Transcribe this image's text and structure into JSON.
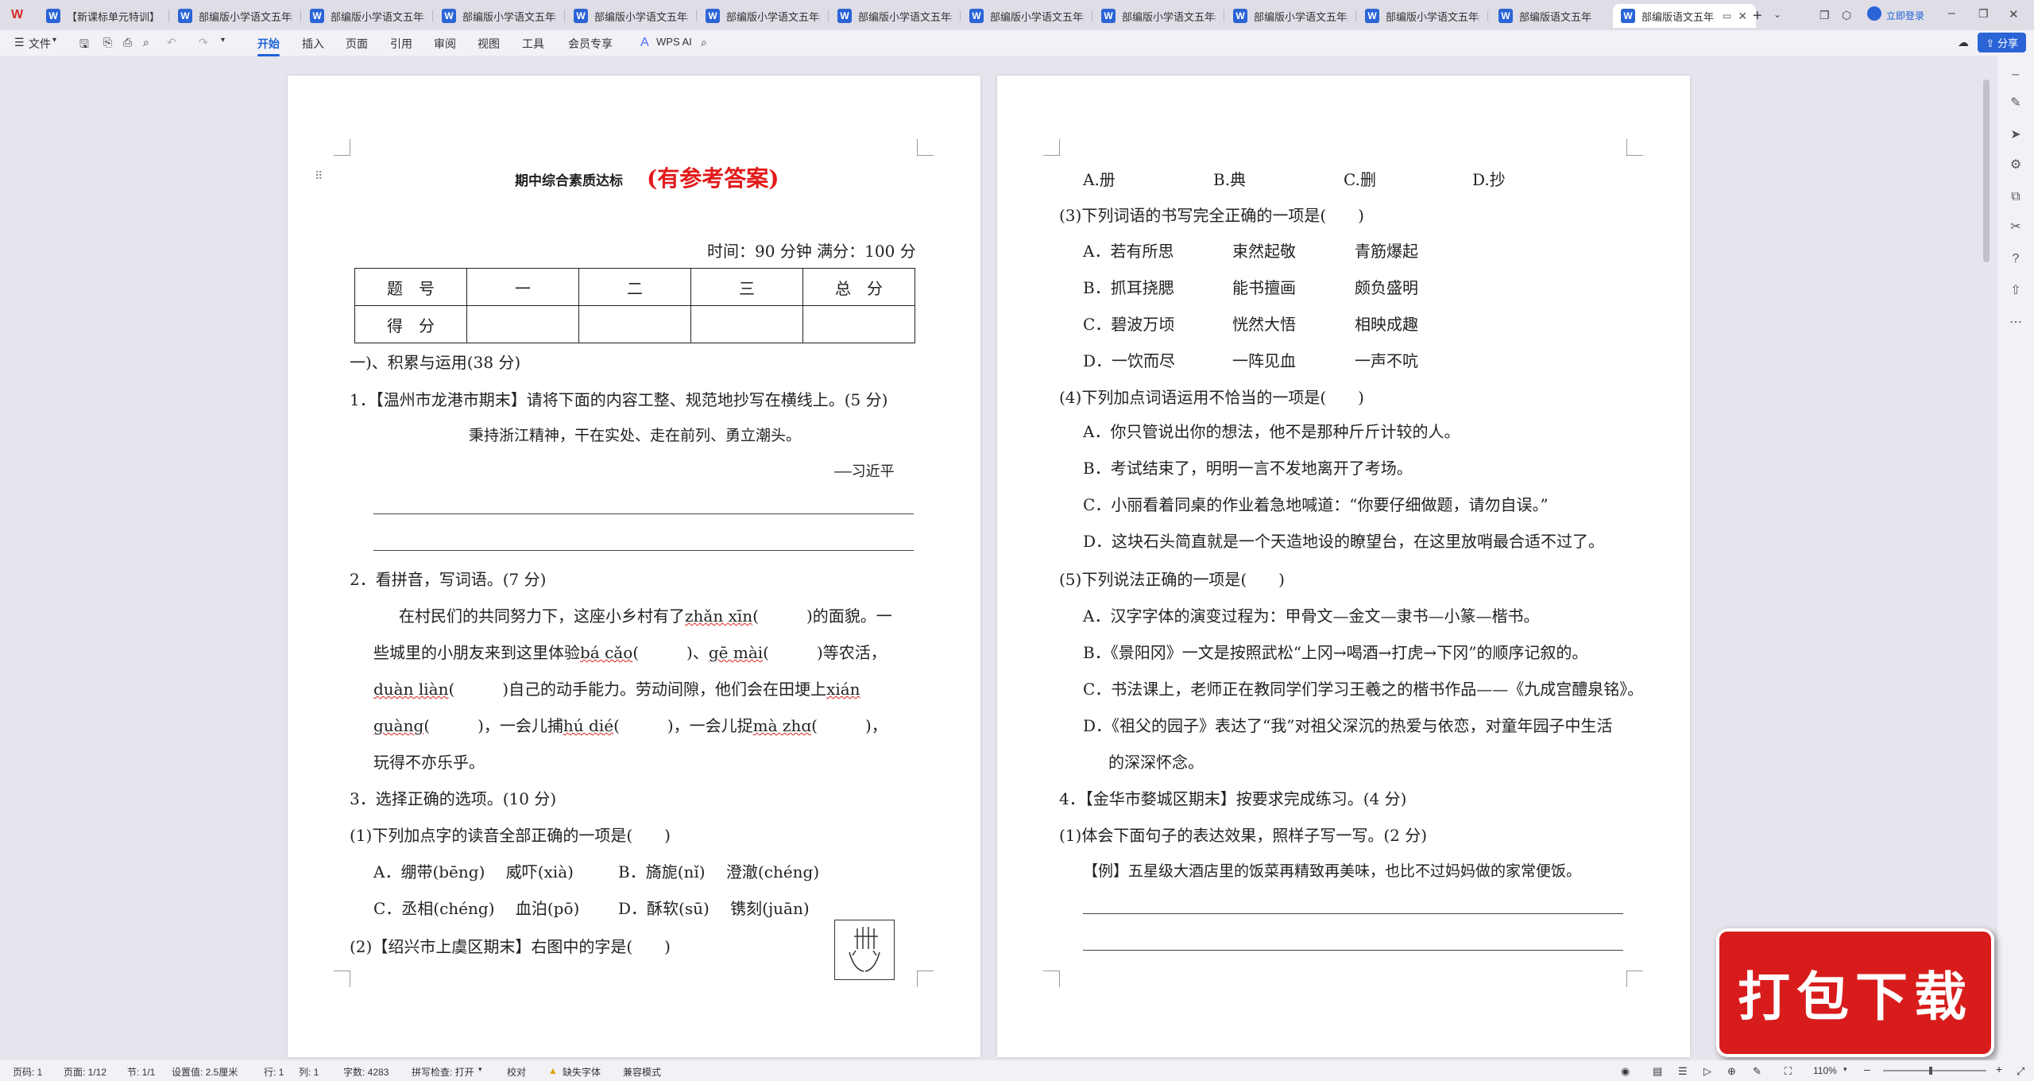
{
  "app": {
    "tabs": [
      "【新课标单元特训】",
      "部编版小学语文五年级",
      "部编版小学语文五年级",
      "部编版小学语文五年级",
      "部编版小学语文五年级",
      "部编版小学语文五年级",
      "部编版小学语文五年级",
      "部编版小学语文五年级",
      "部编版小学语文五年级",
      "部编版小学语文五年级",
      "部编版小学语文五年级",
      "部编版语文五年"
    ],
    "login": "立即登录",
    "share": "分享",
    "file_menu": "文件",
    "menus": [
      "开始",
      "插入",
      "页面",
      "引用",
      "审阅",
      "视图",
      "工具",
      "会员专享"
    ],
    "wps_ai": "WPS AI"
  },
  "status": {
    "page_code": "页码: 1",
    "page": "页面: 1/12",
    "section": "节: 1/1",
    "setting": "设置值: 2.5厘米",
    "row": "行: 1",
    "col": "列: 1",
    "words": "字数: 4283",
    "spell": "拼写检查: 打开",
    "proof": "校对",
    "missing_font": "缺失字体",
    "compat": "兼容模式",
    "zoom": "110%"
  },
  "doc": {
    "title_small": "期中综合素质达标",
    "title_big": "(有参考答案)",
    "time_line": "时间：90 分钟   满分：100 分",
    "table_header": [
      "题　号",
      "一",
      "二",
      "三",
      "总　分"
    ],
    "table_row2": "得　分",
    "sec1": "一)、积累与运用(38 分)",
    "q1": "1．【温州市龙港市期末】请将下面的内容工整、规范地抄写在横线上。(5 分)",
    "q1_quote": "秉持浙江精神，干在实处、走在前列、勇立潮头。",
    "q1_author": "——习近平",
    "q2": "2．看拼音，写词语。(7 分)",
    "q2_l1a": "在村民们的共同努力下，这座小乡村有了",
    "q2_p1": "zhǎn xīn",
    "q2_l1b": "的面貌。一",
    "q2_l2a": "些城里的小朋友来到这里体验",
    "q2_p2": "bá cǎo",
    "q2_p3": "gē mài",
    "q2_l2b": "等农活，",
    "q2_p4": "duàn liàn",
    "q2_l3a": "自己的动手能力。劳动间隙，他们会在田埂上",
    "q2_p5": "xián",
    "q2_p5b": "guàng",
    "q2_l4a": "，一会儿捕",
    "q2_p6": "hú dié",
    "q2_l4b": "，一会儿捉",
    "q2_p7": "mà zhɑ",
    "q2_l5": "玩得不亦乐乎。",
    "q3": "3．选择正确的选项。(10 分)",
    "q3_1": "(1)下列加点字的读音全部正确的一项是(　　)",
    "q3_1a": "A．绷带(bēng)　 威吓(xià)",
    "q3_1b": "B．旖旎(nǐ)　 澄澈(chéng)",
    "q3_1c": "C．丞相(chéng)　 血泊(pō)",
    "q3_1d": "D．酥软(sū)　 镌刻(juān)",
    "q3_2": "(2)【绍兴市上虞区期末】右图中的字是(　　)",
    "p2_opts": [
      "A.册",
      "B.典",
      "C.删",
      "D.抄"
    ],
    "q3_3": "(3)下列词语的书写完全正确的一项是(　　)",
    "q3_3a": [
      "A．若有所思",
      "束然起敬",
      "青筋爆起"
    ],
    "q3_3b": [
      "B．抓耳挠腮",
      "能书擅画",
      "颇负盛明"
    ],
    "q3_3c": [
      "C．碧波万顷",
      "恍然大悟",
      "相映成趣"
    ],
    "q3_3d": [
      "D．一饮而尽",
      "一阵见血",
      "一声不吭"
    ],
    "q3_4": "(4)下列加点词语运用不恰当的一项是(　　)",
    "q3_4a": "A．你只管说出你的想法，他不是那种斤斤计较的人。",
    "q3_4b": "B．考试结束了，明明一言不发地离开了考场。",
    "q3_4c": "C．小丽看着同桌的作业着急地喊道：“你要仔细做题，请勿自误。”",
    "q3_4d": "D．这块石头简直就是一个天造地设的瞭望台，在这里放哨最合适不过了。",
    "q3_5": "(5)下列说法正确的一项是(　　)",
    "q3_5a": "A．汉字字体的演变过程为：甲骨文—金文—隶书—小篆—楷书。",
    "q3_5b": "B．《景阳冈》一文是按照武松“上冈→喝酒→打虎→下冈”的顺序记叙的。",
    "q3_5c": "C．书法课上，老师正在教同学们学习王羲之的楷书作品——《九成宫醴泉铭》。",
    "q3_5d1": "D．《祖父的园子》表达了“我”对祖父深沉的热爱与依恋，对童年园子中生活",
    "q3_5d2": "的深深怀念。",
    "q4": "4．【金华市婺城区期末】按要求完成练习。(4 分)",
    "q4_1": "(1)体会下面句子的表达效果，照样子写一写。(2 分)",
    "q4_ex": "【例】五星级大酒店里的饭菜再精致再美味，也比不过妈妈做的家常便饭。"
  },
  "stamp_text": "打包下载"
}
